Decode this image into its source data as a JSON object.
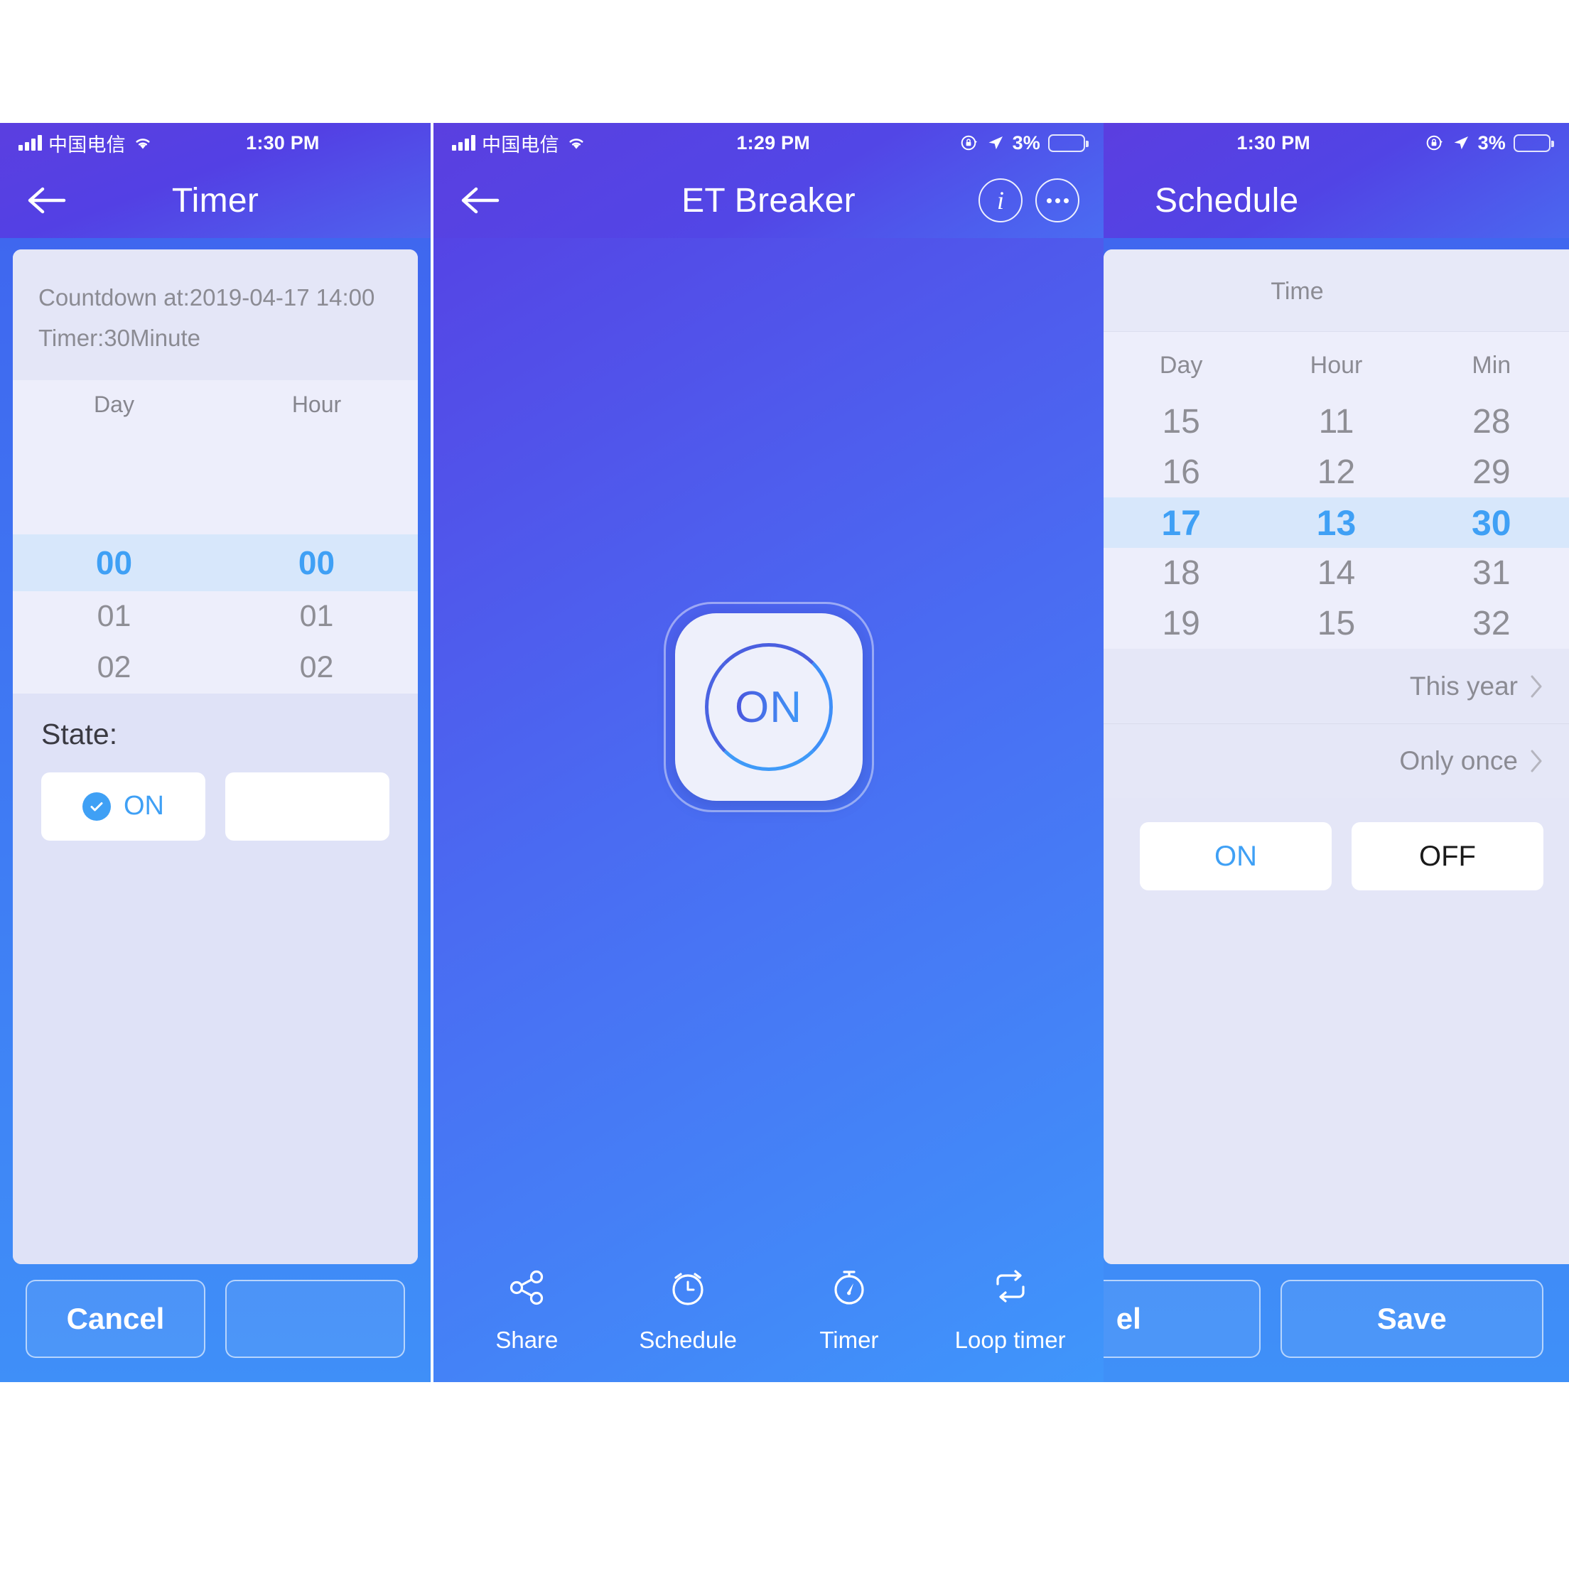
{
  "panels": {
    "timer": {
      "statusbar": {
        "carrier": "中国电信",
        "time": "1:30 PM"
      },
      "nav": {
        "title": "Timer",
        "back_icon": "back-arrow-icon"
      },
      "summary": {
        "countdown": "Countdown at:2019-04-17 14:00",
        "timer": "Timer:30Minute"
      },
      "wheel": {
        "headers": [
          "Day",
          "Hour"
        ],
        "rows": [
          {
            "values": [
              "",
              ""
            ],
            "selected": false
          },
          {
            "values": [
              "",
              ""
            ],
            "selected": false
          },
          {
            "values": [
              "00",
              "00"
            ],
            "selected": true
          },
          {
            "values": [
              "01",
              "01"
            ],
            "selected": false
          },
          {
            "values": [
              "02",
              "02"
            ],
            "selected": false
          }
        ]
      },
      "state": {
        "label": "State:",
        "options": [
          {
            "label": "ON",
            "selected": true
          },
          {
            "label": "",
            "selected": false
          }
        ]
      },
      "footer": {
        "cancel": "Cancel",
        "save": ""
      }
    },
    "device": {
      "statusbar": {
        "carrier": "中国电信",
        "time": "1:29 PM",
        "battery": "3%"
      },
      "nav": {
        "title": "ET Breaker",
        "back_icon": "back-arrow-icon",
        "info_label": "i",
        "more_icon": "more-dots-icon"
      },
      "power": {
        "label": "ON"
      },
      "tabs": [
        {
          "label": "Share",
          "icon": "share-icon"
        },
        {
          "label": "Schedule",
          "icon": "alarm-clock-icon"
        },
        {
          "label": "Timer",
          "icon": "stopwatch-icon"
        },
        {
          "label": "Loop timer",
          "icon": "repeat-icon"
        }
      ]
    },
    "schedule": {
      "statusbar": {
        "time": "1:30 PM",
        "battery": "3%"
      },
      "nav": {
        "title": "Schedule"
      },
      "time_label": "Time",
      "wheel": {
        "headers": [
          "Day",
          "Hour",
          "Min"
        ],
        "rows": [
          {
            "values": [
              "15",
              "11",
              "28"
            ],
            "selected": false
          },
          {
            "values": [
              "16",
              "12",
              "29"
            ],
            "selected": false
          },
          {
            "values": [
              "17",
              "13",
              "30"
            ],
            "selected": true
          },
          {
            "values": [
              "18",
              "14",
              "31"
            ],
            "selected": false
          },
          {
            "values": [
              "19",
              "15",
              "32"
            ],
            "selected": false
          }
        ]
      },
      "options": [
        {
          "label": "This year",
          "chevron": "chevron-right-icon"
        },
        {
          "label": "Only once",
          "chevron": "chevron-right-icon"
        }
      ],
      "state": {
        "options": [
          {
            "label": "ON",
            "selected": true
          },
          {
            "label": "OFF",
            "selected": false
          }
        ]
      },
      "footer": {
        "cancel": "el",
        "save": "Save"
      }
    }
  },
  "colors": {
    "accent_blue": "#3fa0f5",
    "header_purple": "#5340e4",
    "body_blue": "#3f8ff8",
    "battery_red": "#fa2b32",
    "card_bg": "#e8eaf9",
    "selected_row": "#d7e7fb"
  }
}
